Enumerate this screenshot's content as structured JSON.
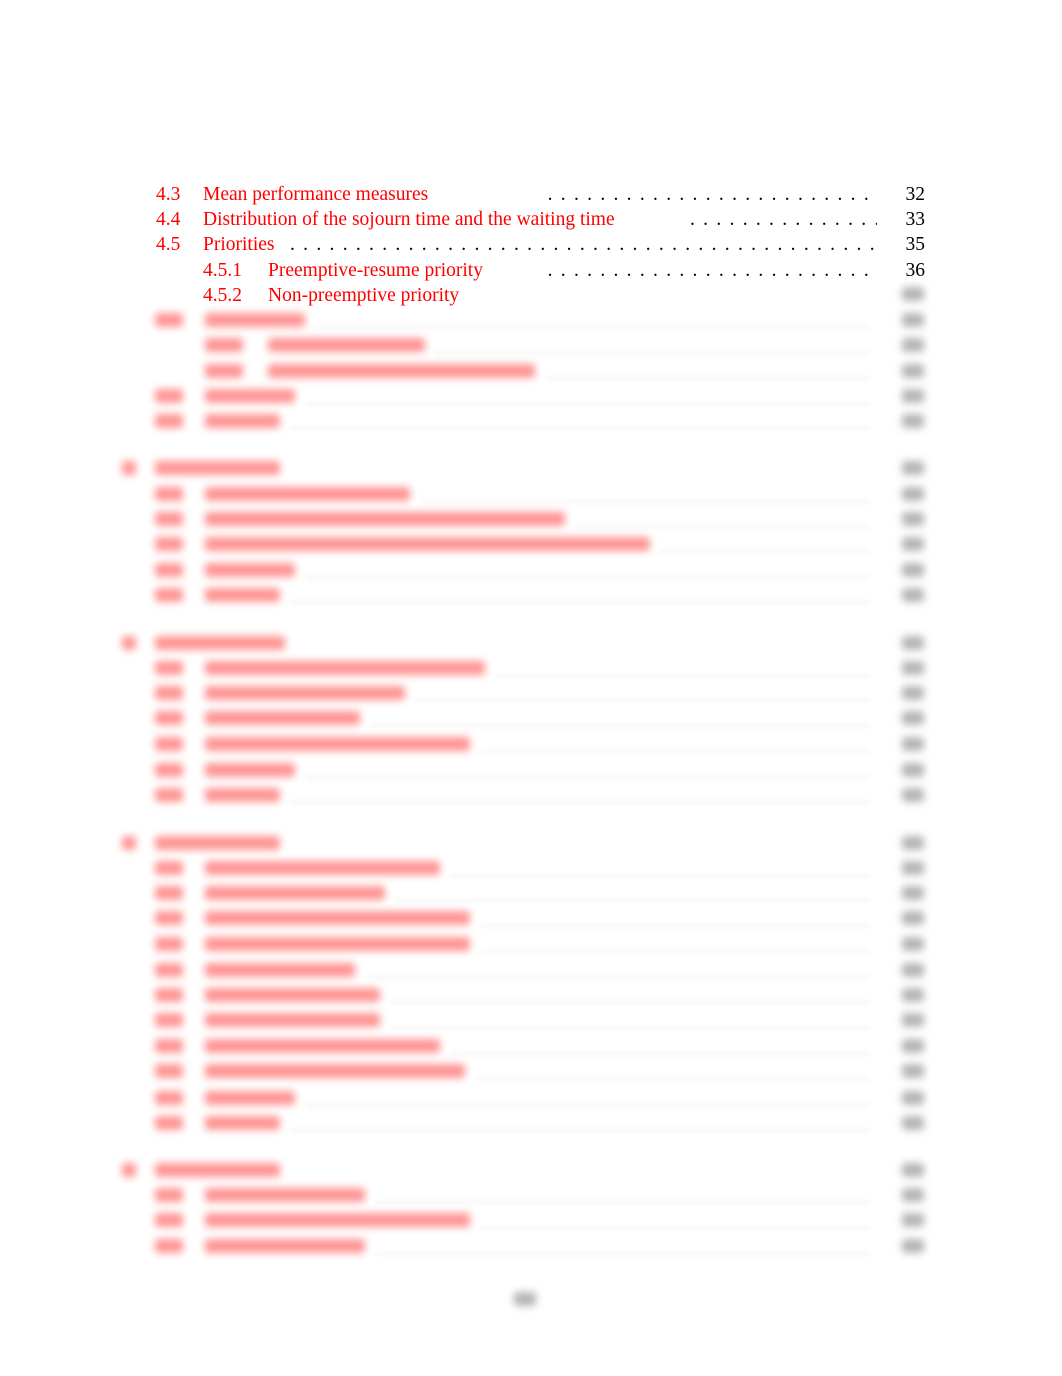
{
  "toc_entries": [
    {
      "number": "4.3",
      "title": "Mean performance measures",
      "page": "32",
      "level": 2
    },
    {
      "number": "4.4",
      "title": "Distribution of the sojourn time and the waiting time",
      "page": "33",
      "level": 2
    },
    {
      "number": "4.5",
      "title": "Priorities",
      "page": "35",
      "level": 2
    },
    {
      "number": "4.5.1",
      "title": "Preemptive-resume priority",
      "page": "36",
      "level": 3
    },
    {
      "number": "4.5.2",
      "title": "Non-preemptive priority",
      "page": "",
      "level": 3
    }
  ],
  "colors": {
    "link": "#ff0000",
    "text": "#000000"
  }
}
